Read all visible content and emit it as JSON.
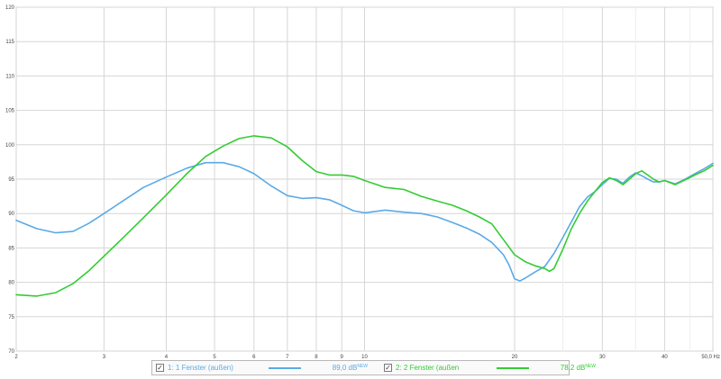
{
  "chart_data": {
    "type": "line",
    "x_scale": "log",
    "xlim": [
      2,
      50
    ],
    "ylim": [
      70,
      120
    ],
    "grid": true,
    "x_ticks": [
      {
        "v": 2,
        "label": "2"
      },
      {
        "v": 3,
        "label": "3"
      },
      {
        "v": 4,
        "label": "4"
      },
      {
        "v": 5,
        "label": "5"
      },
      {
        "v": 6,
        "label": "6"
      },
      {
        "v": 7,
        "label": "7"
      },
      {
        "v": 8,
        "label": "8"
      },
      {
        "v": 9,
        "label": "9"
      },
      {
        "v": 10,
        "label": "10"
      },
      {
        "v": 20,
        "label": "20"
      },
      {
        "v": 30,
        "label": "30"
      },
      {
        "v": 40,
        "label": "40"
      },
      {
        "v": 50,
        "label": "50,0 Hz"
      }
    ],
    "y_ticks": [
      {
        "v": 70,
        "label": "70"
      },
      {
        "v": 75,
        "label": "75"
      },
      {
        "v": 80,
        "label": "80"
      },
      {
        "v": 85,
        "label": "85"
      },
      {
        "v": 90,
        "label": "90"
      },
      {
        "v": 95,
        "label": "95"
      },
      {
        "v": 100,
        "label": "100"
      },
      {
        "v": 105,
        "label": "105"
      },
      {
        "v": 110,
        "label": "110"
      },
      {
        "v": 115,
        "label": "115"
      },
      {
        "v": 120,
        "label": "120"
      }
    ],
    "series": [
      {
        "name": "1: 1 Fenster (außen)",
        "color": "#5aaae6",
        "points": [
          [
            2,
            89.0
          ],
          [
            2.2,
            87.8
          ],
          [
            2.4,
            87.2
          ],
          [
            2.6,
            87.4
          ],
          [
            2.8,
            88.6
          ],
          [
            3,
            90.0
          ],
          [
            3.3,
            92.0
          ],
          [
            3.6,
            93.8
          ],
          [
            4,
            95.3
          ],
          [
            4.4,
            96.6
          ],
          [
            4.8,
            97.4
          ],
          [
            5.2,
            97.4
          ],
          [
            5.6,
            96.8
          ],
          [
            6,
            95.8
          ],
          [
            6.5,
            94.0
          ],
          [
            7,
            92.6
          ],
          [
            7.5,
            92.2
          ],
          [
            8,
            92.3
          ],
          [
            8.5,
            92.0
          ],
          [
            9,
            91.2
          ],
          [
            9.5,
            90.4
          ],
          [
            10,
            90.1
          ],
          [
            11,
            90.5
          ],
          [
            12,
            90.2
          ],
          [
            13,
            90.0
          ],
          [
            14,
            89.5
          ],
          [
            15,
            88.7
          ],
          [
            16,
            87.9
          ],
          [
            17,
            87.0
          ],
          [
            18,
            85.8
          ],
          [
            19,
            84.0
          ],
          [
            19.5,
            82.5
          ],
          [
            20,
            80.5
          ],
          [
            20.5,
            80.2
          ],
          [
            21,
            80.6
          ],
          [
            22,
            81.5
          ],
          [
            23,
            82.3
          ],
          [
            24,
            84.2
          ],
          [
            25,
            86.5
          ],
          [
            26,
            88.8
          ],
          [
            27,
            91.0
          ],
          [
            28,
            92.4
          ],
          [
            29,
            93.2
          ],
          [
            30,
            94.2
          ],
          [
            31,
            95.1
          ],
          [
            32,
            95.0
          ],
          [
            33,
            94.4
          ],
          [
            34,
            95.3
          ],
          [
            35,
            95.9
          ],
          [
            36,
            95.5
          ],
          [
            37,
            95.0
          ],
          [
            38,
            94.6
          ],
          [
            39,
            94.6
          ],
          [
            40,
            94.8
          ],
          [
            42,
            94.3
          ],
          [
            44,
            95.0
          ],
          [
            46,
            95.8
          ],
          [
            48,
            96.5
          ],
          [
            50,
            97.3
          ]
        ]
      },
      {
        "name": "2: 2 Fenster (außen",
        "color": "#33cc33",
        "points": [
          [
            2,
            78.2
          ],
          [
            2.2,
            78.0
          ],
          [
            2.4,
            78.5
          ],
          [
            2.6,
            79.8
          ],
          [
            2.8,
            81.7
          ],
          [
            3,
            83.8
          ],
          [
            3.3,
            86.7
          ],
          [
            3.6,
            89.4
          ],
          [
            4,
            92.7
          ],
          [
            4.4,
            95.8
          ],
          [
            4.8,
            98.3
          ],
          [
            5.2,
            99.8
          ],
          [
            5.6,
            100.9
          ],
          [
            6,
            101.3
          ],
          [
            6.5,
            101.0
          ],
          [
            7,
            99.7
          ],
          [
            7.5,
            97.7
          ],
          [
            8,
            96.1
          ],
          [
            8.5,
            95.6
          ],
          [
            9,
            95.6
          ],
          [
            9.5,
            95.4
          ],
          [
            10,
            94.8
          ],
          [
            11,
            93.8
          ],
          [
            12,
            93.5
          ],
          [
            13,
            92.5
          ],
          [
            14,
            91.8
          ],
          [
            15,
            91.2
          ],
          [
            16,
            90.4
          ],
          [
            17,
            89.5
          ],
          [
            18,
            88.5
          ],
          [
            19,
            86.2
          ],
          [
            20,
            84.0
          ],
          [
            21,
            83.0
          ],
          [
            22,
            82.4
          ],
          [
            23,
            82.0
          ],
          [
            23.5,
            81.6
          ],
          [
            24,
            82.0
          ],
          [
            25,
            84.8
          ],
          [
            26,
            87.8
          ],
          [
            27,
            90.0
          ],
          [
            28,
            91.8
          ],
          [
            29,
            93.2
          ],
          [
            30,
            94.5
          ],
          [
            31,
            95.2
          ],
          [
            32,
            94.8
          ],
          [
            33,
            94.2
          ],
          [
            34,
            95.0
          ],
          [
            35,
            95.8
          ],
          [
            36,
            96.2
          ],
          [
            37,
            95.6
          ],
          [
            38,
            95.0
          ],
          [
            39,
            94.6
          ],
          [
            40,
            94.8
          ],
          [
            42,
            94.2
          ],
          [
            44,
            94.9
          ],
          [
            46,
            95.6
          ],
          [
            48,
            96.2
          ],
          [
            50,
            97.0
          ]
        ]
      }
    ]
  },
  "legend": {
    "entries": [
      {
        "check": "✓",
        "label": "1: 1 Fenster (außen)",
        "value": "89,0 dB",
        "value_suffix": "NEW"
      },
      {
        "check": "✓",
        "label": "2: 2 Fenster (außen",
        "value": "78,2 dB",
        "value_suffix": "NEW"
      }
    ]
  }
}
